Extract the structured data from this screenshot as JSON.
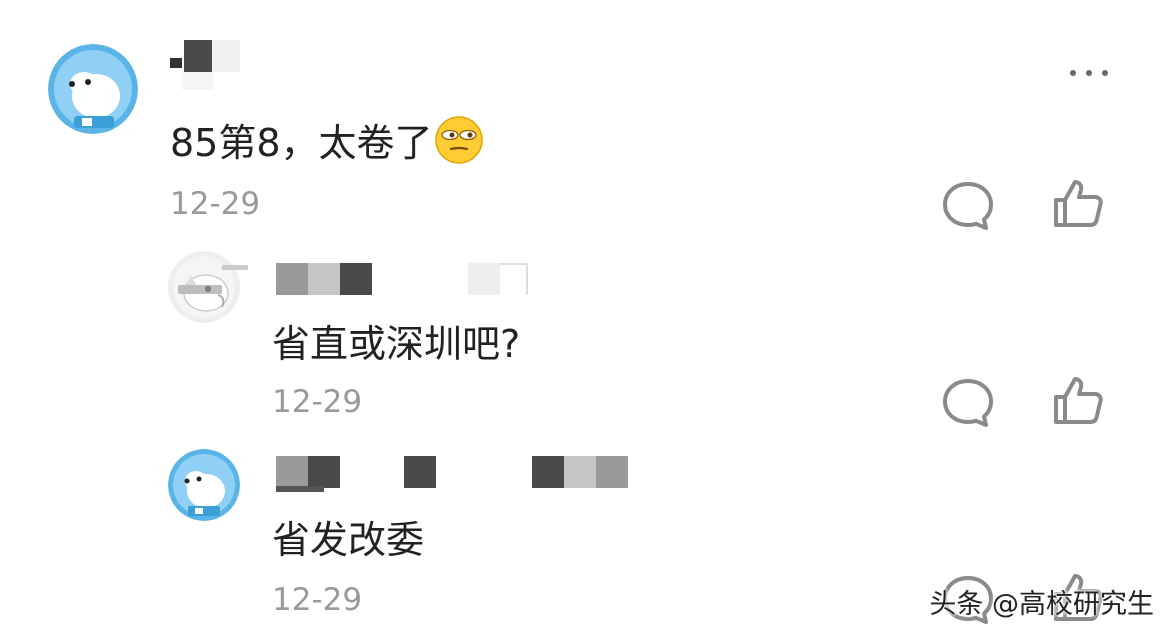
{
  "comments": [
    {
      "text": "85第8，太卷了",
      "emoji_icon": "smirk-face-emoji",
      "time": "12-29"
    },
    {
      "text": "省直或深圳吧?",
      "time": "12-29"
    },
    {
      "text": "省发改委",
      "time": "12-29"
    }
  ],
  "actions": {
    "reply_icon": "comment-bubble-icon",
    "like_icon": "thumbs-up-icon",
    "more_icon": "more-dots-icon"
  },
  "watermark": "头条 @高校研究生",
  "colors": {
    "text": "#222222",
    "secondary": "#999999",
    "avatar_blue": "#5bb4e8",
    "icon_gray": "#8a8a8a"
  }
}
